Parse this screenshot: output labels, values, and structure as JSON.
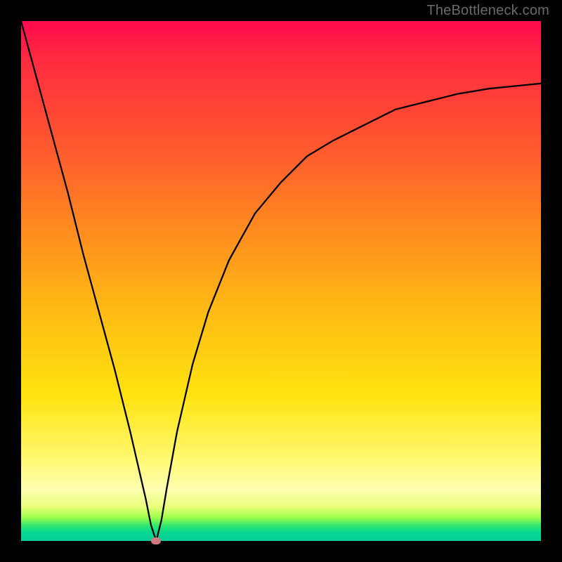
{
  "watermark": "TheBottleneck.com",
  "colors": {
    "frame": "#000000",
    "curve": "#000000",
    "marker": "#d07a80",
    "gradient_top": "#ff0a4e",
    "gradient_bottom": "#06d095"
  },
  "chart_data": {
    "type": "line",
    "title": "",
    "xlabel": "",
    "ylabel": "",
    "xlim": [
      0,
      100
    ],
    "ylim": [
      0,
      100
    ],
    "comment": "Axes have no tick labels; values are normalized 0-100. y represents bottleneck percentage where 0 is optimal (bottom, green) and 100 is worst (top, red). Curve drops steeply from top-left to a minimum near x≈26 then rises asymptotically toward ~88 at the right edge.",
    "series": [
      {
        "name": "bottleneck-curve",
        "x": [
          0,
          3,
          6,
          9,
          12,
          15,
          18,
          21,
          24,
          25,
          26,
          27,
          28,
          30,
          33,
          36,
          40,
          45,
          50,
          55,
          60,
          66,
          72,
          78,
          84,
          90,
          95,
          100
        ],
        "y": [
          100,
          89,
          78,
          67,
          55,
          44,
          33,
          21,
          8,
          3,
          0,
          4,
          10,
          21,
          34,
          44,
          54,
          63,
          69,
          74,
          77,
          80,
          83,
          84.5,
          86,
          87,
          87.5,
          88
        ]
      }
    ],
    "marker": {
      "x": 26,
      "y": 0,
      "name": "optimal-point"
    },
    "background_gradient_stops": [
      {
        "pos": 0,
        "color": "#ff0a4e"
      },
      {
        "pos": 25,
        "color": "#ff5a2e"
      },
      {
        "pos": 55,
        "color": "#ffb915"
      },
      {
        "pos": 84,
        "color": "#fff86e"
      },
      {
        "pos": 95,
        "color": "#9dff4a"
      },
      {
        "pos": 100,
        "color": "#06d095"
      }
    ]
  }
}
